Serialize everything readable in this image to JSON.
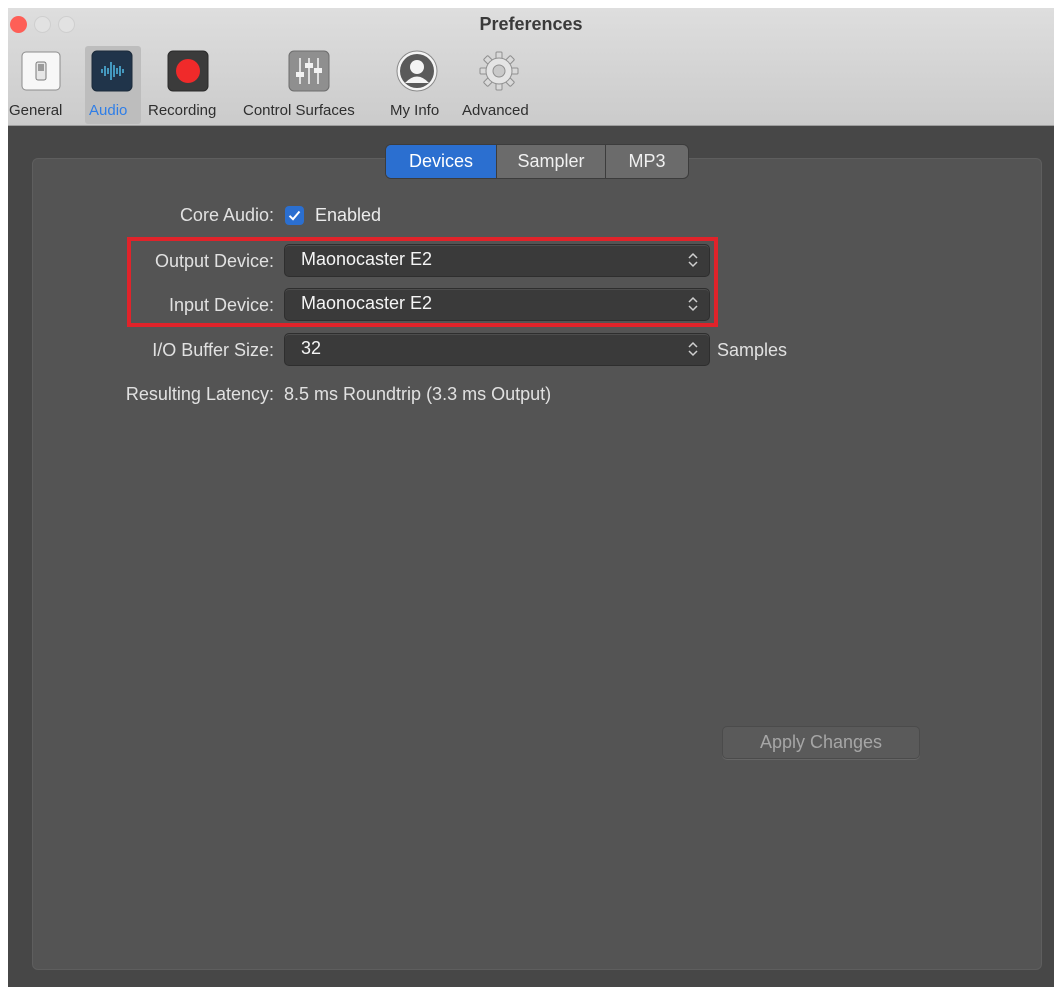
{
  "window": {
    "title": "Preferences"
  },
  "toolbar": {
    "items": [
      {
        "label": "General",
        "icon": "general-switch-icon"
      },
      {
        "label": "Audio",
        "icon": "audio-waveform-icon",
        "active": true
      },
      {
        "label": "Recording",
        "icon": "record-icon"
      },
      {
        "label": "Control Surfaces",
        "icon": "faders-icon"
      },
      {
        "label": "My Info",
        "icon": "user-icon"
      },
      {
        "label": "Advanced",
        "icon": "gear-icon"
      }
    ]
  },
  "tabs": {
    "items": [
      {
        "label": "Devices",
        "active": true
      },
      {
        "label": "Sampler"
      },
      {
        "label": "MP3"
      }
    ]
  },
  "form": {
    "core_audio_label": "Core Audio:",
    "core_audio_checked": true,
    "core_audio_value": "Enabled",
    "output_label": "Output Device:",
    "output_value": "Maonocaster E2",
    "input_label": "Input Device:",
    "input_value": "Maonocaster E2",
    "buffer_label": "I/O Buffer Size:",
    "buffer_value": "32",
    "buffer_unit": "Samples",
    "latency_label": "Resulting Latency:",
    "latency_value": "8.5 ms Roundtrip (3.3 ms Output)"
  },
  "actions": {
    "apply_label": "Apply Changes",
    "apply_enabled": false
  },
  "colors": {
    "accent": "#2b6fd0",
    "highlight_border": "#e0232a",
    "record_red": "#f02a2a"
  }
}
